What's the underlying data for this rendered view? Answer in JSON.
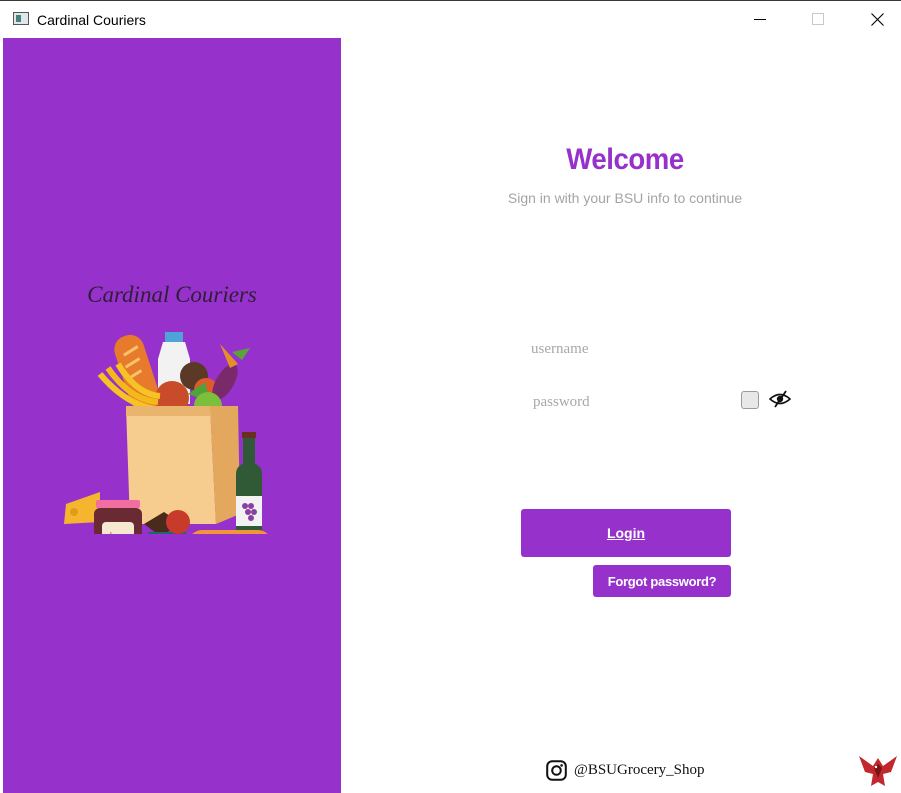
{
  "window": {
    "title": "Cardinal Couriers"
  },
  "left_panel": {
    "brand": "Cardinal Couriers",
    "background_color": "#9731cb",
    "illustration": "grocery-bag-illustration",
    "jam_label": "jam"
  },
  "login": {
    "heading": "Welcome",
    "subtitle": "Sign in with your BSU info to continue",
    "username_placeholder": "username",
    "password_placeholder": "password",
    "show_password_checked": false,
    "eye_icon": "eye-slash-icon",
    "login_label": "Login",
    "forgot_label": "Forgot password?",
    "accent_color": "#9731cb"
  },
  "footer": {
    "social_icon": "instagram-icon",
    "handle": "@BSUGrocery_Shop",
    "logo": "cardinal-logo"
  }
}
